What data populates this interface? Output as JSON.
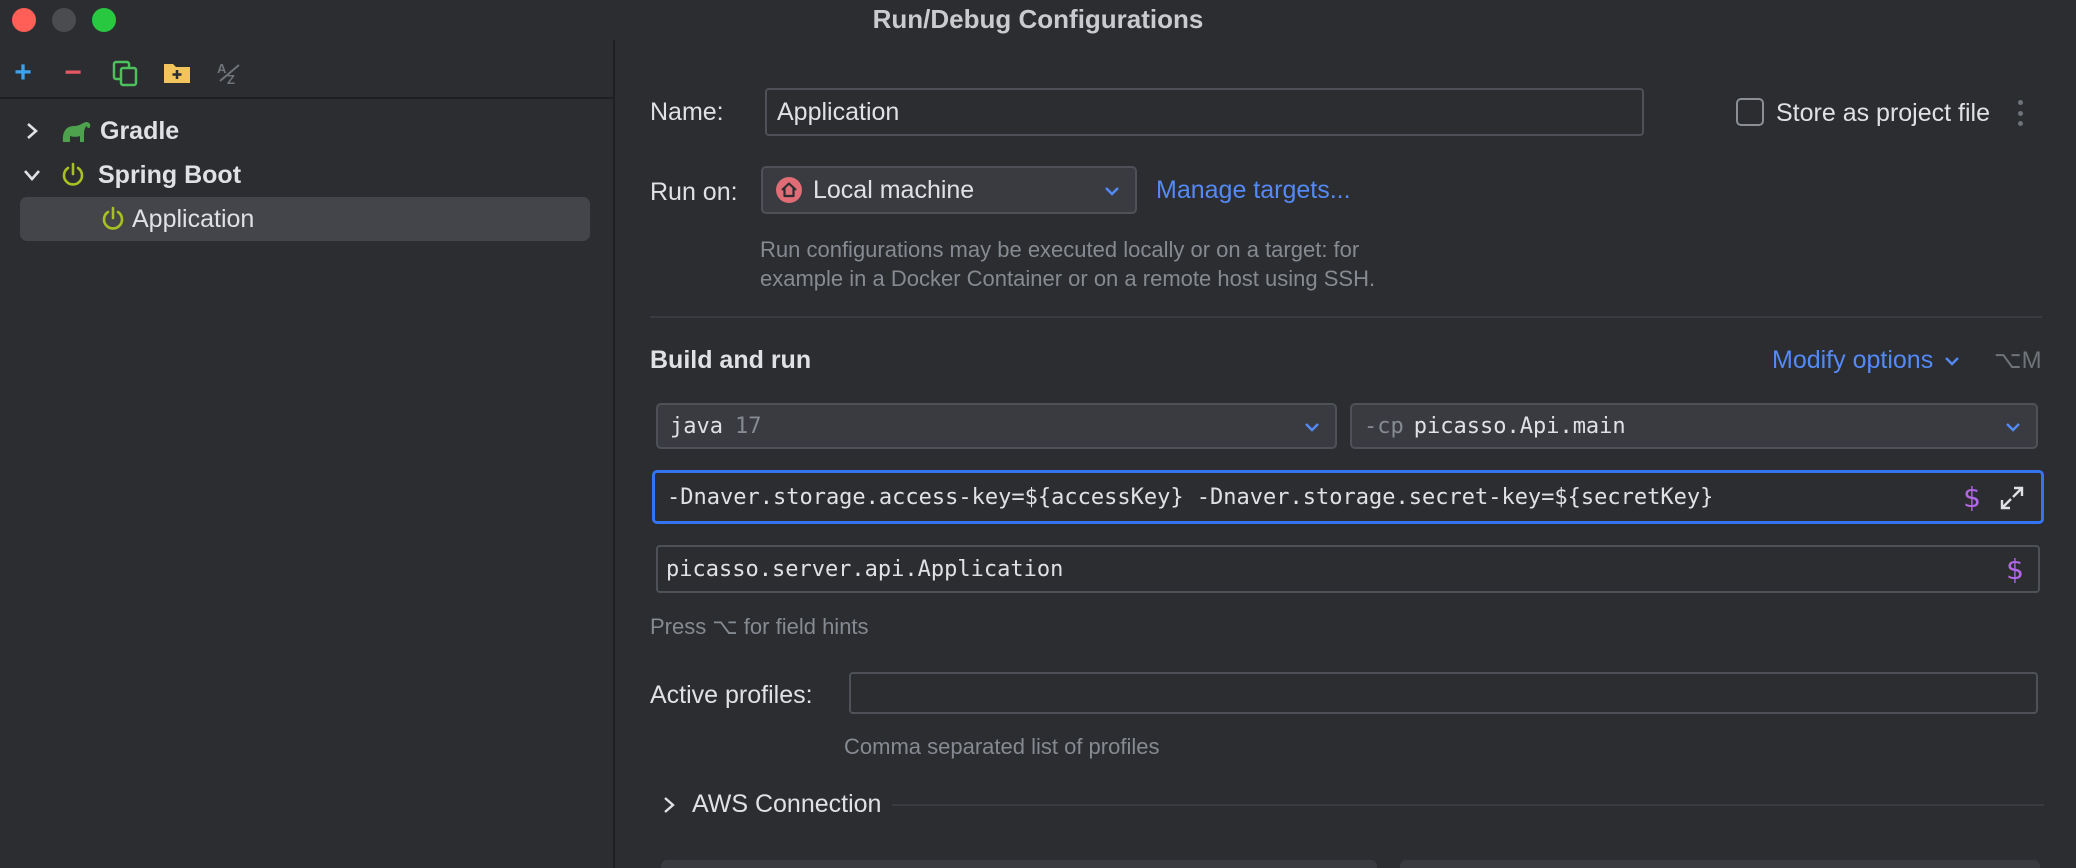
{
  "window": {
    "title": "Run/Debug Configurations"
  },
  "toolbar": {
    "add": "+",
    "remove": "−"
  },
  "tree": {
    "gradle": "Gradle",
    "spring_boot": "Spring Boot",
    "application": "Application"
  },
  "form": {
    "name_label": "Name:",
    "name_value": "Application",
    "store_label": "Store as project file",
    "run_on_label": "Run on:",
    "run_on_value": "Local machine",
    "manage_targets": "Manage targets...",
    "run_hint_1": "Run configurations may be executed locally or on a target: for",
    "run_hint_2": "example in a Docker Container or on a remote host using SSH.",
    "build_run_title": "Build and run",
    "modify_options": "Modify options",
    "modify_shortcut": "⌥M",
    "jdk_name": "java",
    "jdk_version": "17",
    "cp_flag": "-cp",
    "cp_value": "picasso.Api.main",
    "vm_options": "-Dnaver.storage.access-key=${accessKey} -Dnaver.storage.secret-key=${secretKey}",
    "main_class": "picasso.server.api.Application",
    "field_hints": "Press ⌥ for field hints",
    "active_profiles_label": "Active profiles:",
    "active_profiles_value": "",
    "profiles_hint": "Comma separated list of profiles",
    "aws_connection": "AWS Connection"
  },
  "colors": {
    "accent": "#3574f0",
    "link": "#548af7",
    "spring": "#a8c023",
    "gradle": "#3f8e3f"
  }
}
